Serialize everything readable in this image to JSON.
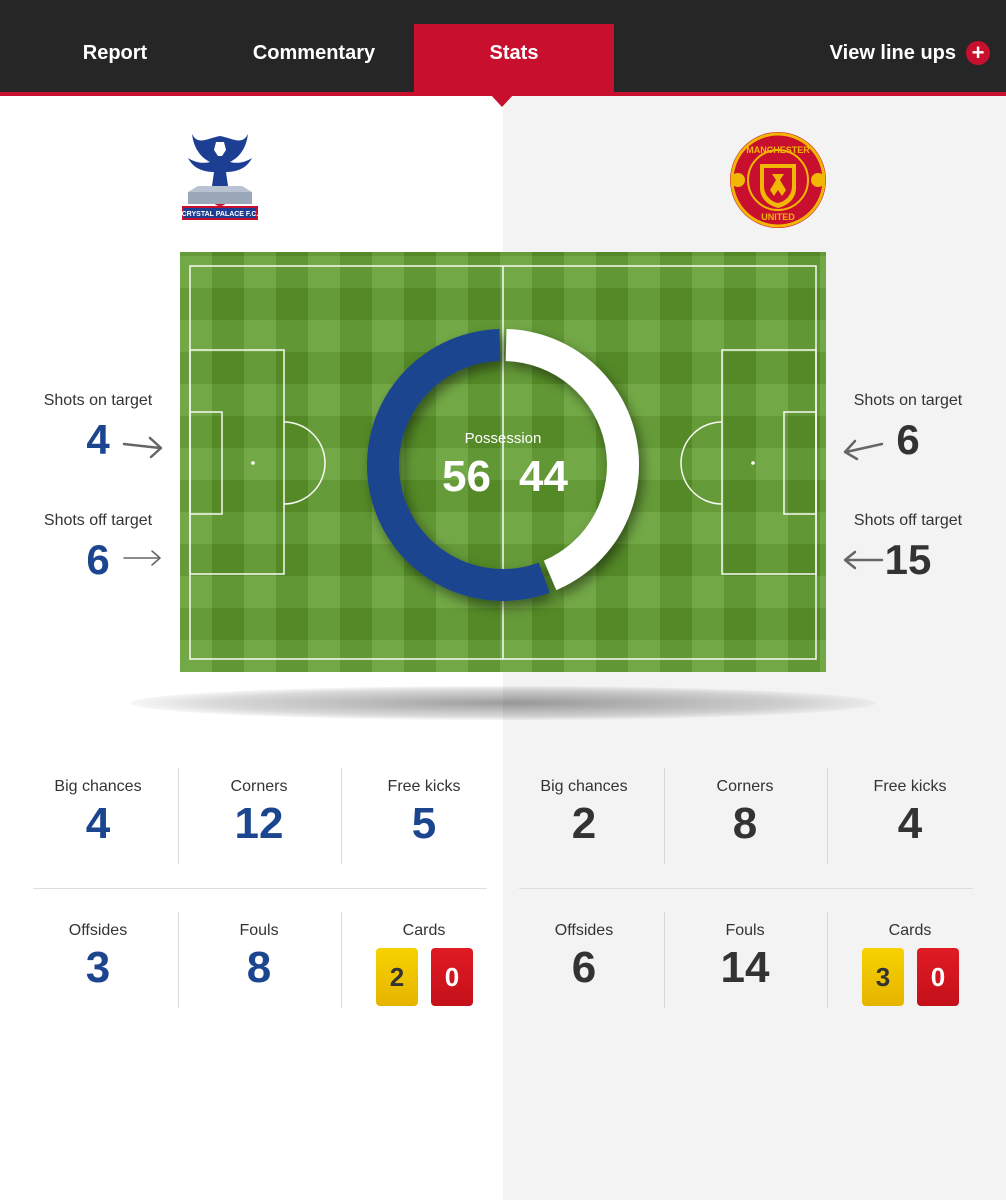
{
  "nav": {
    "tabs": [
      {
        "label": "Report"
      },
      {
        "label": "Commentary"
      },
      {
        "label": "Stats",
        "active": true
      }
    ],
    "lineups_label": "View line ups",
    "accent_color": "#c8102e"
  },
  "teams": {
    "home": {
      "color": "#1c4590",
      "crest": {
        "text": "CRYSTAL PALACE F.C."
      }
    },
    "away": {
      "color": "#333333",
      "crest": {
        "text_top": "MANCHESTER",
        "text_bottom": "UNITED"
      }
    }
  },
  "possession": {
    "label": "Possession",
    "home": 56,
    "away": 44
  },
  "shots": {
    "home": {
      "on_target_label": "Shots on target",
      "on_target": "4",
      "off_target_label": "Shots off target",
      "off_target": "6"
    },
    "away": {
      "on_target_label": "Shots on target",
      "on_target": "6",
      "off_target_label": "Shots off target",
      "off_target": "15"
    }
  },
  "stats": {
    "home": {
      "big_chances_label": "Big chances",
      "big_chances": "4",
      "corners_label": "Corners",
      "corners": "12",
      "free_kicks_label": "Free kicks",
      "free_kicks": "5",
      "offsides_label": "Offsides",
      "offsides": "3",
      "fouls_label": "Fouls",
      "fouls": "8",
      "cards_label": "Cards",
      "yellow_cards": "2",
      "red_cards": "0"
    },
    "away": {
      "big_chances_label": "Big chances",
      "big_chances": "2",
      "corners_label": "Corners",
      "corners": "8",
      "free_kicks_label": "Free kicks",
      "free_kicks": "4",
      "offsides_label": "Offsides",
      "offsides": "6",
      "fouls_label": "Fouls",
      "fouls": "14",
      "cards_label": "Cards",
      "yellow_cards": "3",
      "red_cards": "0"
    }
  }
}
